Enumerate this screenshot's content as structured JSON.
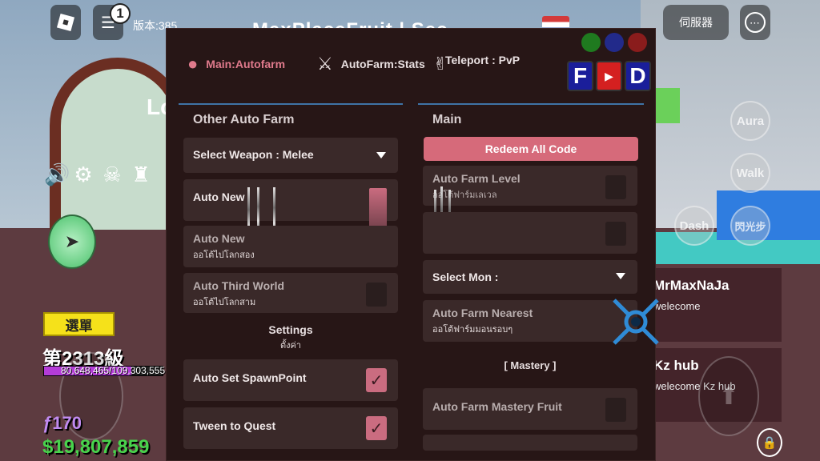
{
  "game_hud": {
    "version": "版本:385",
    "chat_badge": "1",
    "top_title": "MaxPlaceFruit | Sec...",
    "server_button": "伺服器",
    "more_button": "⋯",
    "arch_text": "Lo",
    "menu_button": "選單",
    "level": "第2313級",
    "xp": "80,648,465/109,303,555",
    "xp_fraction": 0.738,
    "fragments": "ƒ170",
    "money": "$19,807,859",
    "skills": {
      "aura": "Aura",
      "walk": "Walk",
      "dash": "Dash",
      "alt": "閃光步"
    },
    "notices": [
      {
        "name": "MrMaxNaJa",
        "message": "welecome"
      },
      {
        "name": "Kz hub",
        "message": "welecome Kz hub"
      }
    ]
  },
  "gui": {
    "tabs": {
      "autofarm": "Main:Autofarm",
      "stats": "AutoFarm:Stats",
      "teleport": "Teleport : PvP"
    },
    "dot_colors": [
      "#1f7a1f",
      "#222a8a",
      "#8a1c1c"
    ],
    "brand": {
      "f": "F",
      "yt": "▶",
      "d": "D"
    },
    "left": {
      "title": "Other Auto Farm",
      "select_weapon": "Select Weapon : Melee",
      "auto_new_1": {
        "title": "Auto New",
        "slider_fraction": 0.6
      },
      "auto_new_2": {
        "title": "Auto New",
        "sub": "ออโต้ไปโลกสอง"
      },
      "auto_third": {
        "title": "Auto Third World",
        "sub": "ออโต้ไปโลกสาม"
      },
      "settings": {
        "title": "Settings",
        "sub": "ตั้งค่า"
      },
      "spawn": {
        "title": "Auto Set SpawnPoint",
        "check": "✓"
      },
      "tween": {
        "title": "Tween to Quest",
        "check": "✓"
      }
    },
    "right": {
      "title": "Main",
      "redeem": "Redeem All Code",
      "farm_level": {
        "title": "Auto Farm Level",
        "sub": "ออโต้ฟาร์มเลเวล"
      },
      "select_mon": "Select Mon :",
      "farm_nearest": {
        "title": "Auto Farm Nearest",
        "sub": "ออโต้ฟาร์มมอนรอบๆ"
      },
      "mastery_header": "[ Mastery ]",
      "mastery_fruit": {
        "title": "Auto Farm Mastery Fruit"
      }
    }
  }
}
